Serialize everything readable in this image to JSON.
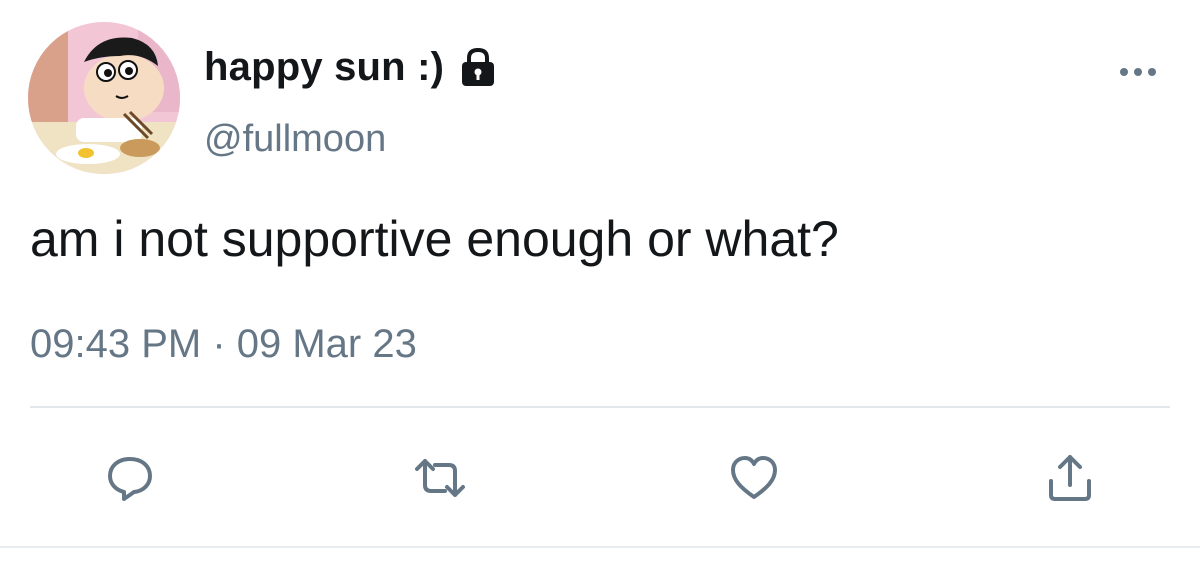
{
  "tweet": {
    "display_name": "happy sun :)",
    "handle": "@fullmoon",
    "text": "am i not supportive enough or what?",
    "timestamp": "09:43 PM · 09 Mar 23",
    "protected": true
  },
  "icons": {
    "lock": "lock-icon",
    "more": "more-icon",
    "reply": "reply-icon",
    "retweet": "retweet-icon",
    "like": "like-icon",
    "share": "share-icon"
  },
  "colors": {
    "text_primary": "#14171a",
    "text_secondary": "#657786",
    "icon": "#657786",
    "divider": "#e1e8ed"
  }
}
